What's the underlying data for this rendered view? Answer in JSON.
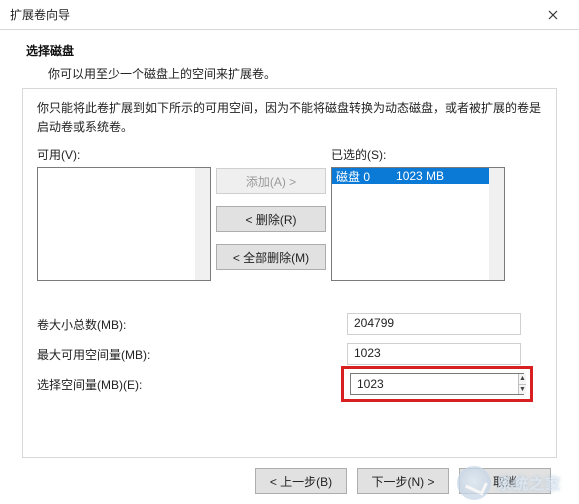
{
  "window": {
    "title": "扩展卷向导"
  },
  "header": {
    "title": "选择磁盘",
    "description": "你可以用至少一个磁盘上的空间来扩展卷。"
  },
  "intro": "你只能将此卷扩展到如下所示的可用空间，因为不能将磁盘转换为动态磁盘，或者被扩展的卷是启动卷或系统卷。",
  "columns": {
    "available_label": "可用(V):",
    "buttons": {
      "add": "添加(A) >",
      "remove": "< 删除(R)",
      "remove_all": "< 全部删除(M)"
    },
    "selected_label": "已选的(S):",
    "selected_items": [
      {
        "name": "磁盘 0",
        "size": "1023 MB"
      }
    ]
  },
  "rows": {
    "total_label": "卷大小总数(MB):",
    "total_value": "204799",
    "max_label": "最大可用空间量(MB):",
    "max_value": "1023",
    "select_label": "选择空间量(MB)(E):",
    "select_value": "1023"
  },
  "footer": {
    "back": "< 上一步(B)",
    "next": "下一步(N) >",
    "cancel": "取消"
  },
  "watermark": {
    "text": "系统之家"
  }
}
